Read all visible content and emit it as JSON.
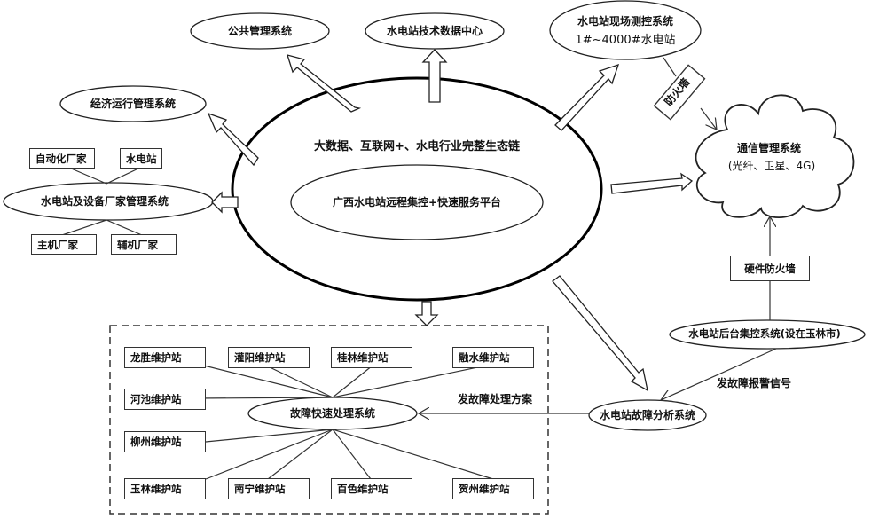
{
  "core": {
    "outer_label": "大数据、互联网+、水电行业完整生态链",
    "inner_label": "广西水电站远程集控+快速服务平台"
  },
  "nodes": {
    "public_mgmt": "公共管理系统",
    "tech_data_center": "水电站技术数据中心",
    "site_monitor_line1": "水电站现场测控系统",
    "site_monitor_line2": "1#~4000#水电站",
    "econ_mgmt": "经济运行管理系统",
    "vendor_mgmt": "水电站及设备厂家管理系统",
    "comm_mgmt_line1": "通信管理系统",
    "comm_mgmt_line2": "(光纤、卫星、4G)",
    "backend_control": "水电站后台集控系统(设在玉林市)",
    "fault_analysis": "水电站故障分析系统",
    "fault_fast": "故障快速处理系统"
  },
  "boxes": {
    "automation_vendor": "自动化厂家",
    "hydro_station": "水电站",
    "main_machine_vendor": "主机厂家",
    "aux_machine_vendor": "辅机厂家",
    "firewall": "防火墙",
    "hw_firewall": "硬件防火墙"
  },
  "stations": [
    "龙胜维护站",
    "灌阳维护站",
    "桂林维护站",
    "融水维护站",
    "河池维护站",
    "柳州维护站",
    "玉林维护站",
    "南宁维护站",
    "百色维护站",
    "贺州维护站"
  ],
  "edge_labels": {
    "alarm_signal": "发故障报警信号",
    "solution": "发故障处理方案"
  }
}
